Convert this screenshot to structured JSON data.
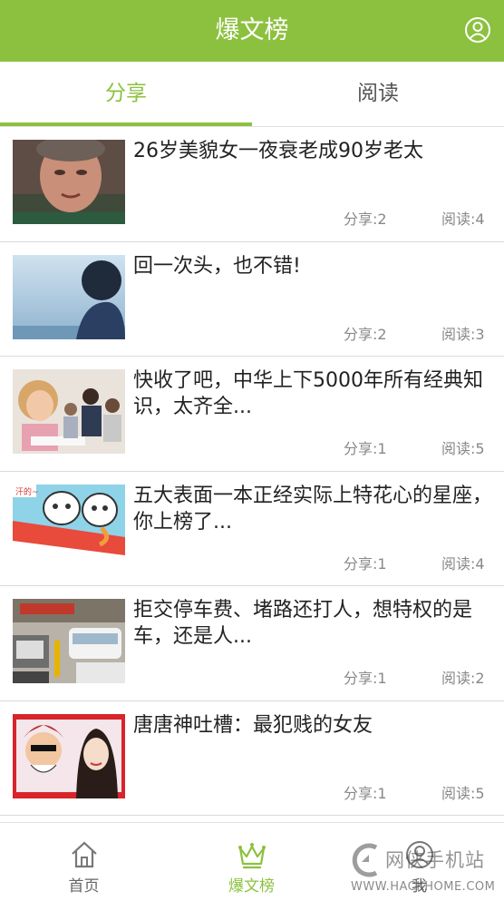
{
  "header": {
    "title": "爆文榜",
    "user_icon": "user-circle-icon"
  },
  "tabs": [
    {
      "label": "分享",
      "active": true
    },
    {
      "label": "阅读",
      "active": false
    }
  ],
  "articles": [
    {
      "title": "26岁美貌女一夜衰老成90岁老太",
      "share": "分享:2",
      "read": "阅读:4"
    },
    {
      "title": "回一次头，也不错!",
      "share": "分享:2",
      "read": "阅读:3"
    },
    {
      "title": "快收了吧，中华上下5000年所有经典知识，太齐全...",
      "share": "分享:1",
      "read": "阅读:5"
    },
    {
      "title": "五大表面一本正经实际上特花心的星座，你上榜了...",
      "share": "分享:1",
      "read": "阅读:4"
    },
    {
      "title": "拒交停车费、堵路还打人，想特权的是车，还是人...",
      "share": "分享:1",
      "read": "阅读:2"
    },
    {
      "title": "唐唐神吐槽：最犯贱的女友",
      "share": "分享:1",
      "read": "阅读:5"
    }
  ],
  "bottom_nav": [
    {
      "label": "首页",
      "icon": "home-icon",
      "active": false
    },
    {
      "label": "爆文榜",
      "icon": "crown-icon",
      "active": true
    },
    {
      "label": "我",
      "icon": "user-icon",
      "active": false
    }
  ],
  "watermark": {
    "text": "网侠手机站",
    "url": "WWW.HACKHOME.COM"
  },
  "colors": {
    "accent": "#8cc13f",
    "divider": "#d9d9d9",
    "muted_text": "#888888"
  }
}
